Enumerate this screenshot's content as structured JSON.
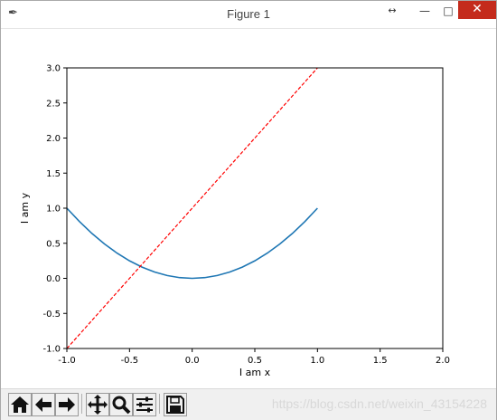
{
  "window": {
    "title": "Figure 1",
    "icon": "feather-icon",
    "controls": {
      "resize_glyph": "↔",
      "minimize_glyph": "—",
      "maximize_glyph": "□",
      "close_glyph": "✕"
    }
  },
  "chart_data": {
    "type": "line",
    "xlabel": "I am x",
    "ylabel": "I am y",
    "xlim": [
      -1.0,
      2.0
    ],
    "ylim": [
      -1.0,
      3.0
    ],
    "xticks": [
      "-1.0",
      "-0.5",
      "0.0",
      "0.5",
      "1.0",
      "1.5",
      "2.0"
    ],
    "yticks": [
      "-1.0",
      "-0.5",
      "0.0",
      "0.5",
      "1.0",
      "1.5",
      "2.0",
      "2.5",
      "3.0"
    ],
    "grid": false,
    "series": [
      {
        "color": "#1f77b4",
        "style": "solid",
        "x": [
          -1.0,
          -0.9,
          -0.8,
          -0.7,
          -0.6,
          -0.5,
          -0.4,
          -0.3,
          -0.2,
          -0.1,
          0.0,
          0.1,
          0.2,
          0.3,
          0.4,
          0.5,
          0.6,
          0.7,
          0.8,
          0.9,
          1.0
        ],
        "y": [
          1.0,
          0.81,
          0.64,
          0.49,
          0.36,
          0.25,
          0.16,
          0.09,
          0.04,
          0.01,
          0.0,
          0.01,
          0.04,
          0.09,
          0.16,
          0.25,
          0.36,
          0.49,
          0.64,
          0.81,
          1.0
        ]
      },
      {
        "color": "#ff0000",
        "style": "dashed",
        "x": [
          -1.0,
          1.0
        ],
        "y": [
          -1.0,
          3.0
        ]
      }
    ]
  },
  "toolbar": {
    "buttons": [
      {
        "name": "home-button",
        "icon": "home-icon"
      },
      {
        "name": "back-button",
        "icon": "arrow-left-icon"
      },
      {
        "name": "forward-button",
        "icon": "arrow-right-icon"
      },
      {
        "name": "pan-button",
        "icon": "move-icon"
      },
      {
        "name": "zoom-button",
        "icon": "magnifier-icon"
      },
      {
        "name": "subplots-button",
        "icon": "sliders-icon"
      },
      {
        "name": "save-button",
        "icon": "floppy-disk-icon"
      }
    ]
  },
  "watermark": "https://blog.csdn.net/weixin_43154228"
}
